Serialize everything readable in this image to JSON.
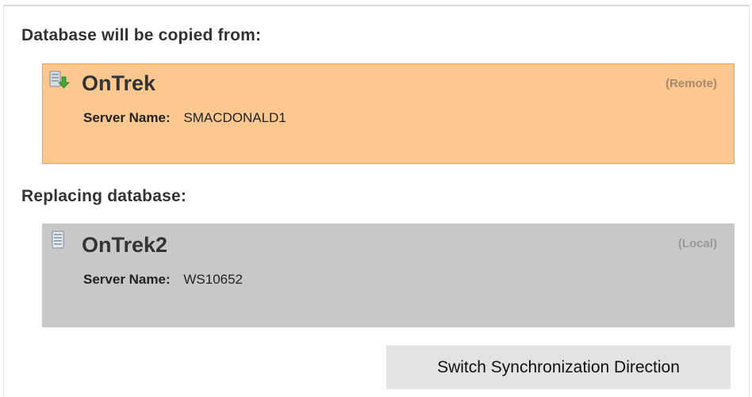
{
  "source": {
    "heading": "Database will be copied from:",
    "database_name": "OnTrek",
    "location": "(Remote)",
    "server_label": "Server Name:",
    "server_name": "SMACDONALD1",
    "icon": "database-download-icon",
    "background_color": "#fdc890",
    "border_color": "#f0a050"
  },
  "target": {
    "heading": "Replacing database:",
    "database_name": "OnTrek2",
    "location": "(Local)",
    "server_label": "Server Name:",
    "server_name": "WS10652",
    "icon": "database-icon",
    "background_color": "#c8c8c8"
  },
  "actions": {
    "switch_direction_label": "Switch Synchronization Direction"
  }
}
